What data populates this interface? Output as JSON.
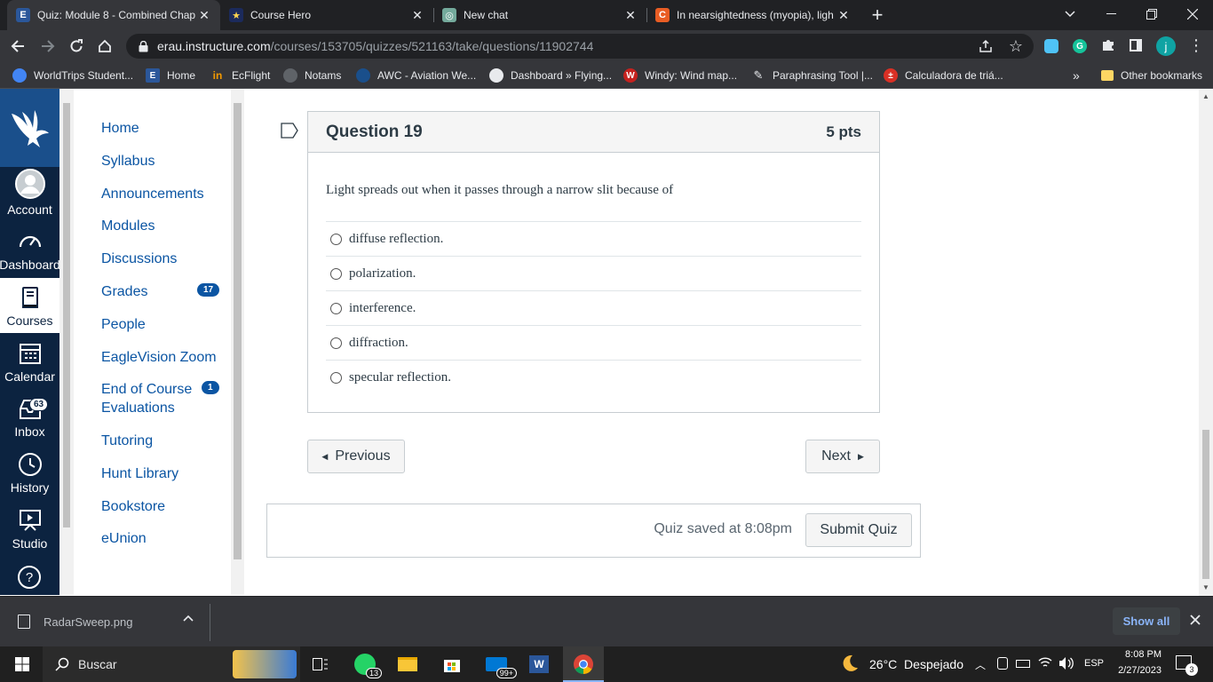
{
  "browser": {
    "tabs": [
      {
        "title": "Quiz: Module 8 - Combined Chap",
        "icon": "E",
        "icon_color": "#2b579a",
        "active": true
      },
      {
        "title": "Course Hero",
        "icon": "★",
        "icon_color": "#1b2a5c",
        "active": false
      },
      {
        "title": "New chat",
        "icon": "◎",
        "icon_color": "#74aa9c",
        "active": false
      },
      {
        "title": "In nearsightedness (myopia), ligh",
        "icon": "C",
        "icon_color": "#e95d24",
        "active": false
      }
    ],
    "new_tab": "+",
    "url_host": "erau.instructure.com",
    "url_path": "/courses/153705/quizzes/521163/take/questions/11902744",
    "profile_initial": "j",
    "bookmarks": [
      {
        "label": "WorldTrips Student...",
        "color": "#4285f4"
      },
      {
        "label": "Home",
        "color": "#2b579a"
      },
      {
        "label": "EcFlight",
        "color": "#f29900"
      },
      {
        "label": "Notams",
        "color": "#5f6368"
      },
      {
        "label": "AWC - Aviation We...",
        "color": "#1a4f8b"
      },
      {
        "label": "Dashboard » Flying...",
        "color": "#5f6368"
      },
      {
        "label": "Windy: Wind map...",
        "color": "#c5221f"
      },
      {
        "label": "Paraphrasing Tool |...",
        "color": "#3c4043"
      },
      {
        "label": "Calculadora de triá...",
        "color": "#d93025"
      }
    ],
    "other_bookmarks": "Other bookmarks",
    "more_bookmarks": "»"
  },
  "global_nav": {
    "items": [
      {
        "label": "Account"
      },
      {
        "label": "Dashboard"
      },
      {
        "label": "Courses"
      },
      {
        "label": "Calendar"
      },
      {
        "label": "Inbox",
        "badge": "63"
      },
      {
        "label": "History"
      },
      {
        "label": "Studio"
      }
    ],
    "help_icon": "?"
  },
  "course_nav": {
    "items": [
      {
        "label": "Home"
      },
      {
        "label": "Syllabus"
      },
      {
        "label": "Announcements"
      },
      {
        "label": "Modules"
      },
      {
        "label": "Discussions"
      },
      {
        "label": "Grades",
        "badge": "17"
      },
      {
        "label": "People"
      },
      {
        "label": "EagleVision Zoom"
      },
      {
        "label": "End of Course Evaluations",
        "badge": "1"
      },
      {
        "label": "Tutoring"
      },
      {
        "label": "Hunt Library"
      },
      {
        "label": "Bookstore"
      },
      {
        "label": "eUnion"
      }
    ]
  },
  "question": {
    "title": "Question 19",
    "points": "5 pts",
    "text": "Light spreads out when it passes through a narrow slit because of",
    "answers": [
      "diffuse reflection.",
      "polarization.",
      "interference.",
      "diffraction.",
      "specular reflection."
    ],
    "selected": null
  },
  "navigation": {
    "previous": "Previous",
    "next": "Next"
  },
  "save": {
    "status": "Quiz saved at 8:08pm",
    "submit": "Submit Quiz"
  },
  "downloads": {
    "file": "RadarSweep.png",
    "show_all": "Show all"
  },
  "taskbar": {
    "search": "Buscar",
    "weather": "26°C  Despejado",
    "lang": "ESP",
    "time": "8:08 PM",
    "date": "2/27/2023",
    "whatsapp_badge": "13",
    "mail_badge": "99+",
    "notif_count": "3"
  },
  "colors": {
    "canvas_nav": "#0c2340",
    "link": "#0b55a3",
    "chrome_dark": "#202124"
  }
}
